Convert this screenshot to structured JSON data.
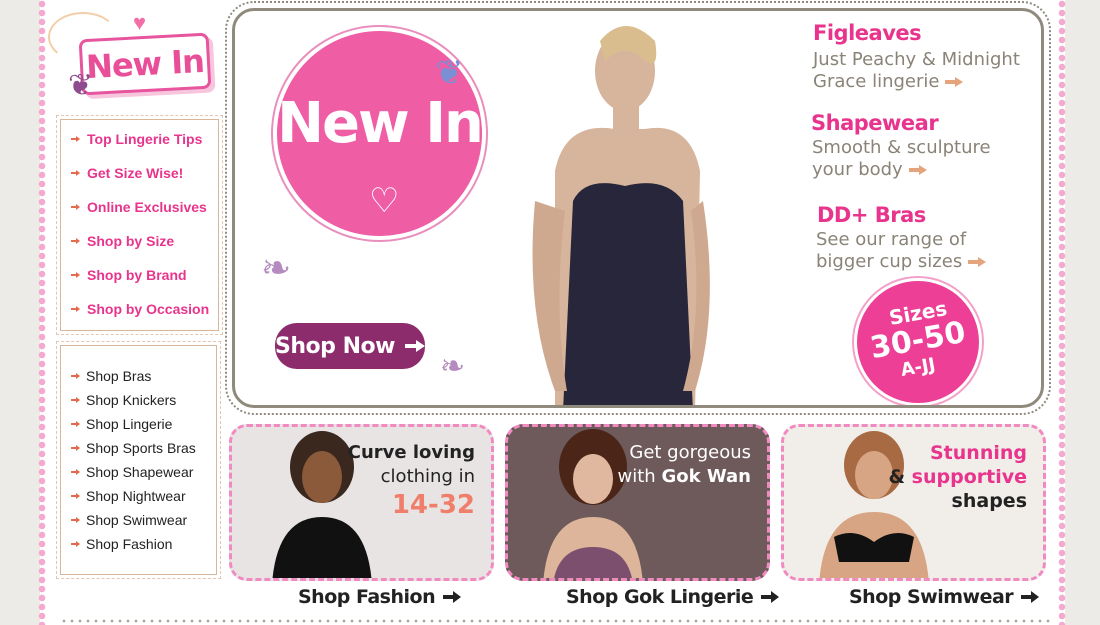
{
  "colors": {
    "accent_pink": "#e8348c",
    "circle_pink": "#ef5da5",
    "button_plum": "#8c2c6d",
    "promo_grey": "#8a8377",
    "arrow_orange": "#e56a4e"
  },
  "sidebar": {
    "badge": "New In",
    "top_links": [
      "Top Lingerie Tips",
      "Get Size Wise!",
      "Online Exclusives",
      "Shop by Size",
      "Shop by Brand",
      "Shop by Occasion"
    ],
    "shop_links": [
      "Shop Bras",
      "Shop Knickers",
      "Shop Lingerie",
      "Shop Sports Bras",
      "Shop Shapewear",
      "Shop Nightwear",
      "Shop Swimwear",
      "Shop Fashion"
    ]
  },
  "hero": {
    "circle_title": "New In",
    "shop_now": "Shop Now",
    "promos": [
      {
        "title": "Figleaves",
        "line1": "Just Peachy & Midnight",
        "line2": "Grace lingerie"
      },
      {
        "title": "Shapewear",
        "line1": "Smooth & sculpture",
        "line2": "your body"
      },
      {
        "title": "DD+ Bras",
        "line1": "See our range of",
        "line2": "bigger cup sizes"
      }
    ],
    "sizes_badge": {
      "label": "Sizes",
      "range": "30-50",
      "cups": "A-JJ"
    }
  },
  "tiles": [
    {
      "caption1": "Curve loving",
      "caption2": "clothing in",
      "caption3": "14-32",
      "link": "Shop Fashion"
    },
    {
      "caption1": "Get gorgeous",
      "caption2": "with",
      "caption2b": "Gok Wan",
      "link": "Shop Gok Lingerie"
    },
    {
      "caption1": "Stunning",
      "caption2a": "&",
      "caption2b": "supportive",
      "caption3": "shapes",
      "link": "Shop Swimwear"
    }
  ],
  "icons": [
    "heart-icon",
    "butterfly-icon",
    "arrow-right-icon"
  ]
}
